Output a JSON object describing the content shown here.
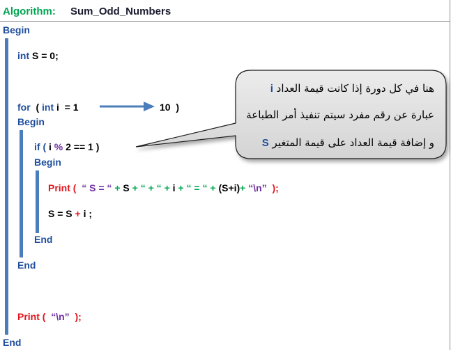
{
  "header": {
    "algorithm_label": "Algorithm:",
    "algorithm_name": "Sum_Odd_Numbers"
  },
  "code": {
    "begin_outer": "Begin",
    "decl_kw": "int",
    "decl_rest": "S = 0;",
    "for_kw": "for",
    "for_paren_open": "(",
    "for_int": "int",
    "for_init": "i  = 1",
    "for_end": "10  )",
    "begin_for": "Begin",
    "if_kw": "if (",
    "if_var": "i",
    "if_mod": "%",
    "if_rest": "2 == 1 )",
    "begin_if": "Begin",
    "print1": {
      "kw": "Print (",
      "s1": "“ S = “",
      "p1": "+",
      "v1": "S",
      "p2": "+",
      "s2": "“ + “",
      "p3": "+",
      "v2": "i",
      "p4": "+",
      "s3": "“ = “",
      "p5": "+",
      "v3": "(S+i)",
      "p6": "+",
      "s4": "“\\n”",
      "close": ");"
    },
    "assign_left": "S = S",
    "assign_op": "+",
    "assign_right": "i ;",
    "end_if": "End",
    "end_for": "End",
    "print2": {
      "kw": "Print (",
      "s": "“\\n”",
      "close": ");"
    },
    "end_outer": "End"
  },
  "callout": {
    "line1": "هنا في كل دورة إذا كانت قيمة العداد",
    "line1_var": "i",
    "line2": "عبارة عن رقم مفرد سيتم تنفيذ أمر الطباعة",
    "line3": "و إضافة قيمة العداد على قيمة المتغير",
    "line3_var": "S"
  },
  "colors": {
    "keyword": "#1f4e9c",
    "print": "#e3141c",
    "string": "#00a651",
    "modulo": "#7030a0",
    "bar": "#4a7ebb",
    "callout_fill": "#e3e3e3"
  }
}
